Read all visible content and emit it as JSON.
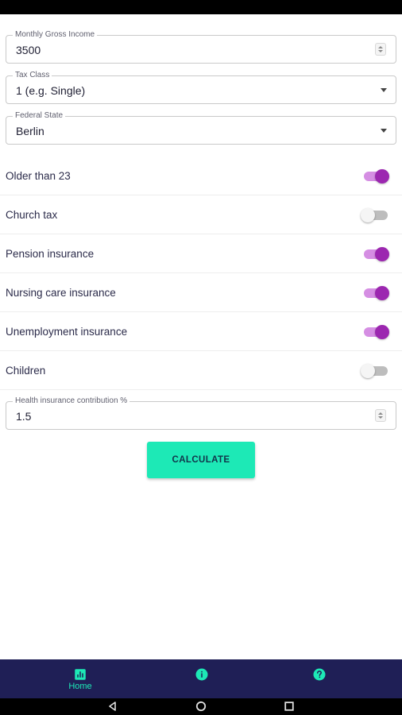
{
  "form": {
    "gross_income": {
      "label": "Monthly Gross Income",
      "value": "3500"
    },
    "tax_class": {
      "label": "Tax Class",
      "value": "1 (e.g. Single)"
    },
    "federal_state": {
      "label": "Federal State",
      "value": "Berlin"
    },
    "health_contribution": {
      "label": "Health insurance contribution %",
      "value": "1.5"
    }
  },
  "switches": [
    {
      "label": "Older than 23",
      "on": true
    },
    {
      "label": "Church tax",
      "on": false
    },
    {
      "label": "Pension insurance",
      "on": true
    },
    {
      "label": "Nursing care insurance",
      "on": true
    },
    {
      "label": "Unemployment insurance",
      "on": true
    },
    {
      "label": "Children",
      "on": false
    }
  ],
  "calculate_label": "CALCULATE",
  "bottom_nav": {
    "items": [
      {
        "label": "Home",
        "icon": "bar-chart-icon",
        "active": true
      },
      {
        "label": "",
        "icon": "info-icon",
        "active": false
      },
      {
        "label": "",
        "icon": "help-icon",
        "active": false
      }
    ]
  },
  "colors": {
    "accent": "#1de9b6",
    "toggle_on": "#9c27b0",
    "toggle_track_on": "#d58ee3",
    "nav_background": "#1f1f56"
  },
  "system_nav": {
    "icons": [
      "back-icon",
      "home-circle-icon",
      "recents-icon"
    ]
  }
}
